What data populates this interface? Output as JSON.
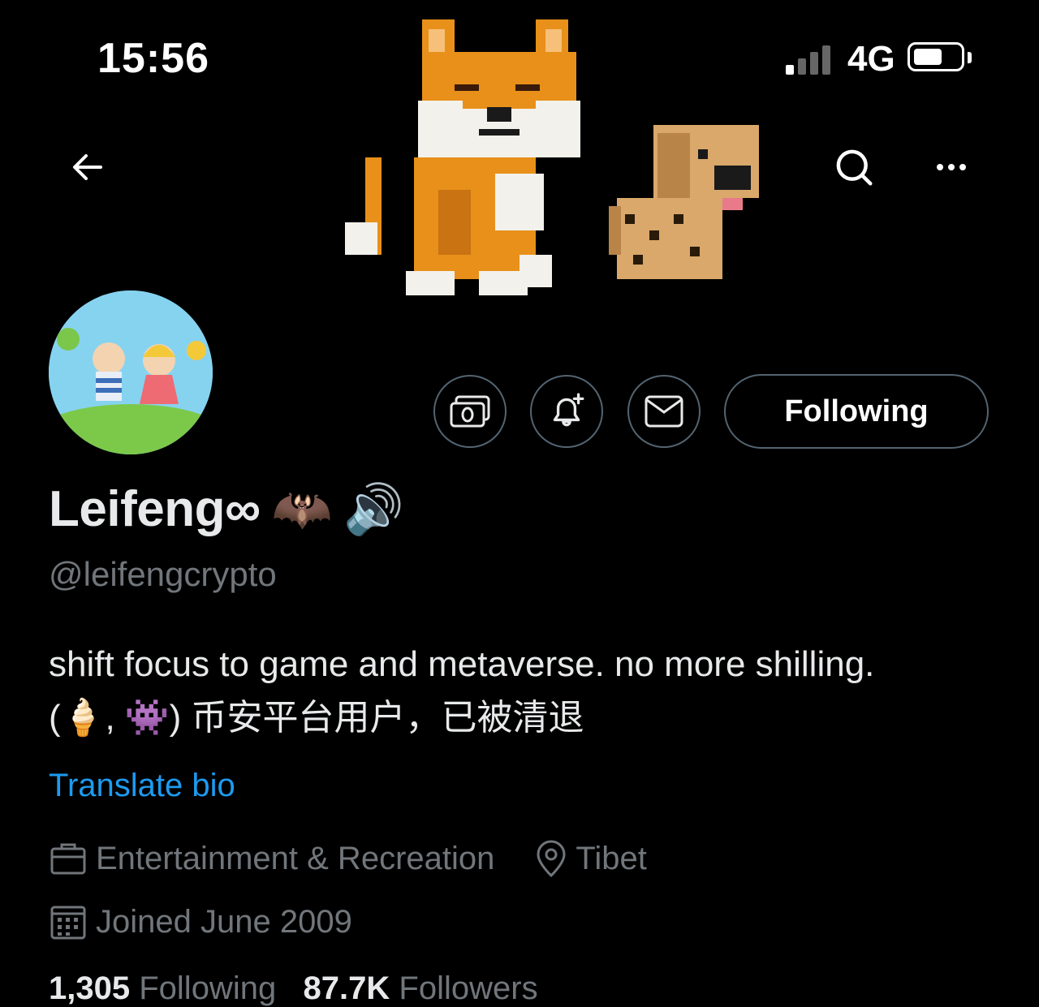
{
  "status_bar": {
    "time": "15:56",
    "network": "4G"
  },
  "nav": {
    "back_icon": "arrow-left-icon",
    "search_icon": "search-icon",
    "more_icon": "more-horizontal-icon"
  },
  "profile": {
    "display_name": "Leifeng∞",
    "name_emojis": [
      "🦇",
      "🔊"
    ],
    "handle": "@leifengcrypto",
    "bio_line1": "shift focus to game and metaverse. no more shilling.",
    "bio_line2": "(🍦, 👾) 币安平台用户，已被清退",
    "translate_label": "Translate bio",
    "category": "Entertainment & Recreation",
    "location": "Tibet",
    "joined": "Joined June 2009",
    "following_count": "1,305",
    "following_label": "Following",
    "followers_count": "87.7K",
    "followers_label": "Followers"
  },
  "actions": {
    "tip_icon": "money-icon",
    "notify_icon": "bell-plus-icon",
    "message_icon": "mail-icon",
    "follow_label": "Following"
  },
  "colors": {
    "background": "#000000",
    "link": "#1d9bf0",
    "muted": "#71767b",
    "border": "#536471"
  }
}
